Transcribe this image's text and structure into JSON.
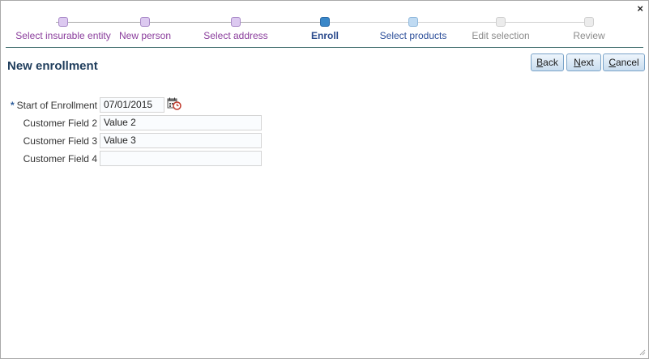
{
  "dialog": {
    "close_symbol": "×",
    "title": "New enrollment"
  },
  "wizard": {
    "steps": [
      {
        "label": "Select insurable entity",
        "state": "done"
      },
      {
        "label": "New person",
        "state": "done"
      },
      {
        "label": "Select address",
        "state": "done"
      },
      {
        "label": "Enroll",
        "state": "current"
      },
      {
        "label": "Select products",
        "state": "next"
      },
      {
        "label": "Edit selection",
        "state": "future"
      },
      {
        "label": "Review",
        "state": "future"
      }
    ]
  },
  "buttons": {
    "back": {
      "accel": "B",
      "rest": "ack"
    },
    "next": {
      "accel": "N",
      "rest": "ext"
    },
    "cancel": {
      "accel": "C",
      "rest": "ancel"
    }
  },
  "form": {
    "required_marker": "*",
    "start": {
      "label": "Start of Enrollment",
      "value": "07/01/2015"
    },
    "field2": {
      "label": "Customer Field 2",
      "value": "Value 2"
    },
    "field3": {
      "label": "Customer Field 3",
      "value": "Value 3"
    },
    "field4": {
      "label": "Customer Field 4",
      "value": ""
    }
  },
  "icons": {
    "close": "close-icon",
    "calendar": "calendar-clock-icon",
    "resize": "resize-grip-icon"
  },
  "colors": {
    "done_step": "#8a3d9c",
    "current_step": "#2a4a8c",
    "future_step": "#8c8c8c",
    "title": "#1f3d5c",
    "button_border": "#7aa3c8"
  }
}
